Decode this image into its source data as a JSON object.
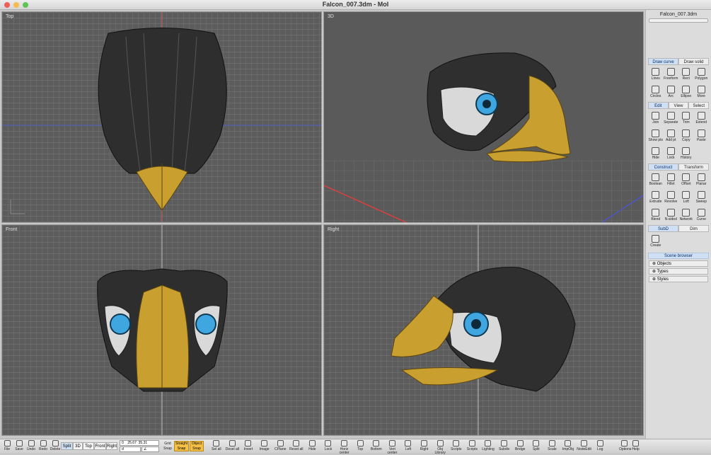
{
  "window": {
    "title": "Falcon_007.3dm - MoI"
  },
  "colors": {
    "viewport_bg": "#5c5c5c",
    "accent": "#3b6fd4",
    "beak": "#c9a030",
    "eye": "#3fa6e0"
  },
  "viewports": {
    "top": "Top",
    "persp": "3D",
    "front": "Front",
    "right": "Right"
  },
  "panel": {
    "file": "Falcon_007.3dm",
    "draw_tabs": [
      "Draw curve",
      "Draw solid"
    ],
    "draw_tools": [
      [
        "Lines",
        "line-icon"
      ],
      [
        "Freeform",
        "freeform-icon"
      ],
      [
        "Rect",
        "rect-icon"
      ],
      [
        "Polygon",
        "polygon-icon"
      ],
      [
        "Circles",
        "circle-icon"
      ],
      [
        "Arc",
        "arc-icon"
      ],
      [
        "Ellipse",
        "ellipse-icon"
      ],
      [
        "More",
        "more-icon"
      ]
    ],
    "edit_tabs": [
      "Edit",
      "View",
      "Select"
    ],
    "edit_tools": [
      [
        "Join",
        "join-icon"
      ],
      [
        "Separate",
        "separate-icon"
      ],
      [
        "Trim",
        "trim-icon"
      ],
      [
        "Extend",
        "extend-icon"
      ],
      [
        "Show pts",
        "show-points-icon"
      ],
      [
        "Add pt",
        "add-point-icon"
      ],
      [
        "Copy",
        "copy-icon"
      ],
      [
        "Paste",
        "paste-icon"
      ],
      [
        "Hide",
        "hide-icon"
      ],
      [
        "Lock",
        "lock-icon"
      ],
      [
        "History",
        "history-icon"
      ]
    ],
    "construct_tabs": [
      "Construct",
      "Transform"
    ],
    "construct_tools": [
      [
        "Boolean",
        "boolean-icon"
      ],
      [
        "Fillet",
        "fillet-icon"
      ],
      [
        "Offset",
        "offset-icon"
      ],
      [
        "Planar",
        "planar-icon"
      ],
      [
        "Extrude",
        "extrude-icon"
      ],
      [
        "Revolve",
        "revolve-icon"
      ],
      [
        "Loft",
        "loft-icon"
      ],
      [
        "Sweep",
        "sweep-icon"
      ],
      [
        "Blend",
        "blend-icon"
      ],
      [
        "N-sided",
        "nsided-icon"
      ],
      [
        "Network",
        "network-icon"
      ],
      [
        "Curve",
        "curve-icon"
      ]
    ],
    "subd_tabs": [
      "SubD",
      "Dim"
    ],
    "subd_tools": [
      [
        "Create",
        "subd-create-icon"
      ]
    ],
    "scene_browser": "Scene browser",
    "scene_items": [
      "Objects",
      "Types",
      "Styles"
    ]
  },
  "toolbar": {
    "left": [
      [
        "File",
        "folder-icon"
      ],
      [
        "Save",
        "save-icon"
      ],
      [
        "Undo",
        "undo-icon"
      ],
      [
        "Redo",
        "redo-icon"
      ],
      [
        "Delete",
        "delete-icon"
      ]
    ],
    "views": [
      "Split",
      "3D",
      "Top",
      "Front",
      "Right"
    ],
    "coords": {
      "x": "0",
      "y": "25.67",
      "z": "35.31",
      "d": "d",
      "a": "∠"
    },
    "grid": "Grid Snap",
    "straight": "Straight Snap",
    "object": "Object Snap",
    "right": [
      [
        "Sel all",
        "select-all-icon"
      ],
      [
        "Desel all",
        "deselect-all-icon"
      ],
      [
        "Invert",
        "invert-icon"
      ],
      [
        "Image",
        "image-icon"
      ],
      [
        "CPlane",
        "cplane-icon"
      ],
      [
        "Reset all",
        "reset-icon"
      ],
      [
        "Hide",
        "hide-icon"
      ],
      [
        "Lock",
        "lock-icon"
      ],
      [
        "Horiz center",
        "horiz-center-icon"
      ],
      [
        "Top",
        "align-top-icon"
      ],
      [
        "Bottom",
        "align-bottom-icon"
      ],
      [
        "Vert center",
        "vert-center-icon"
      ],
      [
        "Left",
        "align-left-icon"
      ],
      [
        "Right",
        "align-right-icon"
      ],
      [
        "Obj Library",
        "obj-library-icon"
      ],
      [
        "Scripts",
        "scripts-icon"
      ],
      [
        "Scripts",
        "scripts-icon"
      ],
      [
        "Lighting",
        "lighting-icon"
      ],
      [
        "Subdiv",
        "subdiv-icon"
      ],
      [
        "Bridge",
        "bridge-icon"
      ],
      [
        "Split",
        "split-icon"
      ],
      [
        "Scale",
        "scale-icon"
      ],
      [
        "ImpObj",
        "import-obj-icon"
      ],
      [
        "NodeEdit",
        "node-edit-icon"
      ],
      [
        "Log",
        "log-icon"
      ]
    ],
    "options": [
      [
        "Options",
        "options-gear-icon"
      ],
      [
        "Help",
        "help-icon"
      ]
    ]
  }
}
